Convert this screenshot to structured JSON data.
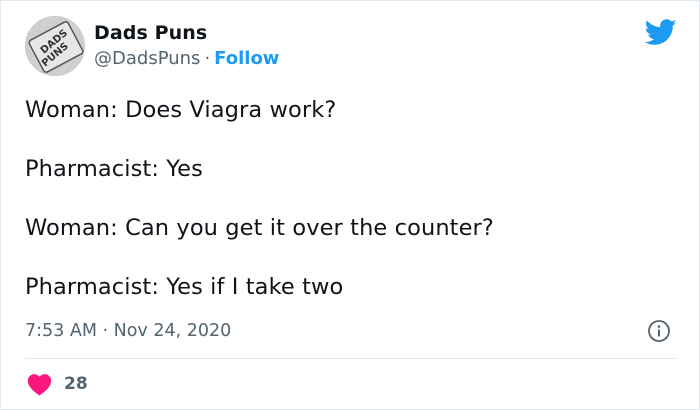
{
  "author": {
    "display_name": "Dads Puns",
    "handle": "@DadsPuns",
    "separator": "·",
    "follow_label": "Follow",
    "avatar_text_top": "DADS",
    "avatar_text_bottom": "PUNS"
  },
  "tweet": {
    "lines": [
      "Woman: Does Viagra work?",
      "Pharmacist: Yes",
      "Woman: Can you get it over the counter?",
      "Pharmacist: Yes if I take two"
    ],
    "timestamp": "7:53 AM · Nov 24, 2020",
    "like_count": "28"
  },
  "icons": {
    "brand": "twitter-bird-icon",
    "info": "info-icon",
    "like": "heart-icon"
  },
  "colors": {
    "accent": "#1d9bf0",
    "heart": "#f91880",
    "secondary_text": "#536471",
    "divider": "#e1e8ed"
  }
}
